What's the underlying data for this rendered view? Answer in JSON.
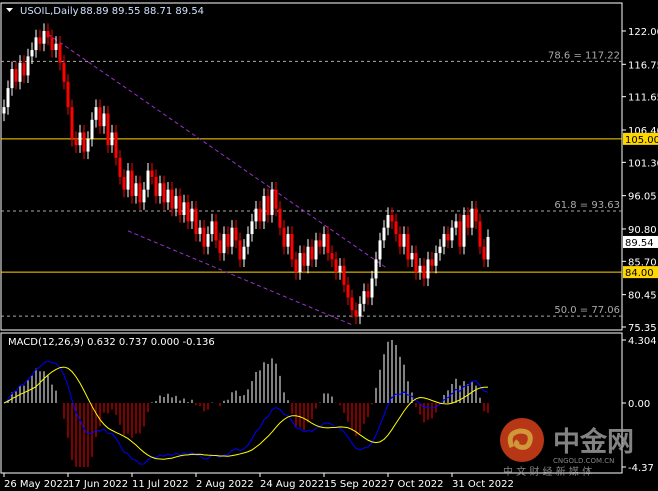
{
  "header": {
    "symbol": "USOIL,Daily",
    "ohlc": "88.89 89.55 88.71 89.54"
  },
  "macd_header": {
    "label": "MACD(12,26,9) 0.632 0.737 0.000 -0.136"
  },
  "price_axis": {
    "ticks": [
      122.0,
      116.75,
      111.65,
      106.4,
      101.3,
      96.05,
      90.8,
      85.7,
      80.45,
      75.35
    ],
    "labels": [
      "122.00",
      "116.75",
      "111.65",
      "106.40",
      "101.30",
      "96.05",
      "90.80",
      "85.70",
      "80.45",
      "75.35"
    ]
  },
  "macd_axis": {
    "labels": [
      "4.304",
      "0.00",
      "-4.37"
    ],
    "values": [
      4.304,
      0,
      -4.37
    ]
  },
  "levels": [
    {
      "label": "105.00",
      "value": 105.0,
      "color": "#ffd700"
    },
    {
      "label": "84.00",
      "value": 84.0,
      "color": "#ffd700"
    }
  ],
  "current_price": {
    "label": "89.54",
    "value": 89.54
  },
  "fibonacci": [
    {
      "label": "78.6 = 117.22",
      "value": 117.22
    },
    {
      "label": "61.8 = 93.63",
      "value": 93.63
    },
    {
      "label": "50.0 = 77.06",
      "value": 77.06
    }
  ],
  "time_axis": {
    "labels": [
      "26 May 2022",
      "17 Jun 2022",
      "11 Jul 2022",
      "2 Aug 2022",
      "24 Aug 2022",
      "15 Sep 2022",
      "7 Oct 2022",
      "31 Oct 2022"
    ],
    "bar_index": [
      0,
      16,
      32,
      48,
      64,
      80,
      96,
      112
    ]
  },
  "watermark": {
    "logo": "中金网",
    "site": "CNGOLD.COM.CN",
    "tagline": "中 文 财 经 新 媒 体"
  },
  "colors": {
    "bull": "#ffffff",
    "bear": "#ff0000",
    "macd": "#0000ff",
    "signal": "#ffff00",
    "trendline": "#9932cc",
    "level": "#ffd700"
  },
  "chart_data": {
    "type": "candlestick",
    "title": "USOIL,Daily",
    "ylim": [
      75.35,
      122.0
    ],
    "closes": [
      110,
      113,
      116,
      114,
      117,
      115,
      118,
      119,
      121,
      120,
      122,
      121,
      119,
      120,
      117,
      114,
      110,
      105,
      104,
      106,
      103,
      105,
      108,
      110,
      107,
      109,
      104,
      106,
      102,
      99,
      97,
      100,
      96,
      98,
      95,
      97,
      100,
      99,
      96,
      98,
      95,
      97,
      94,
      96,
      93,
      95,
      92,
      94,
      90,
      91,
      88,
      90,
      92,
      89,
      87,
      90,
      88,
      91,
      89,
      86,
      88,
      90,
      92,
      94,
      92,
      96,
      93,
      97,
      94,
      91,
      88,
      90,
      86,
      84,
      87,
      85,
      88,
      86,
      89,
      88,
      90,
      87,
      86,
      84,
      85,
      82,
      80,
      78,
      77,
      79,
      81,
      80,
      83,
      86,
      89,
      91,
      93,
      92,
      90,
      88,
      90,
      86,
      87,
      84,
      85,
      83,
      86,
      85,
      87,
      88,
      90,
      89,
      91,
      92,
      88,
      93,
      91,
      94,
      92,
      88,
      86,
      89.54
    ],
    "trendlines": [
      {
        "from": [
          11,
          121.5
        ],
        "to": [
          96,
          84.5
        ]
      },
      {
        "from": [
          31,
          90.5
        ],
        "to": [
          87,
          75.7
        ]
      }
    ],
    "indicator": {
      "name": "MACD",
      "params": [
        12,
        26,
        9
      ],
      "ylim": [
        -4.37,
        4.304
      ]
    }
  }
}
